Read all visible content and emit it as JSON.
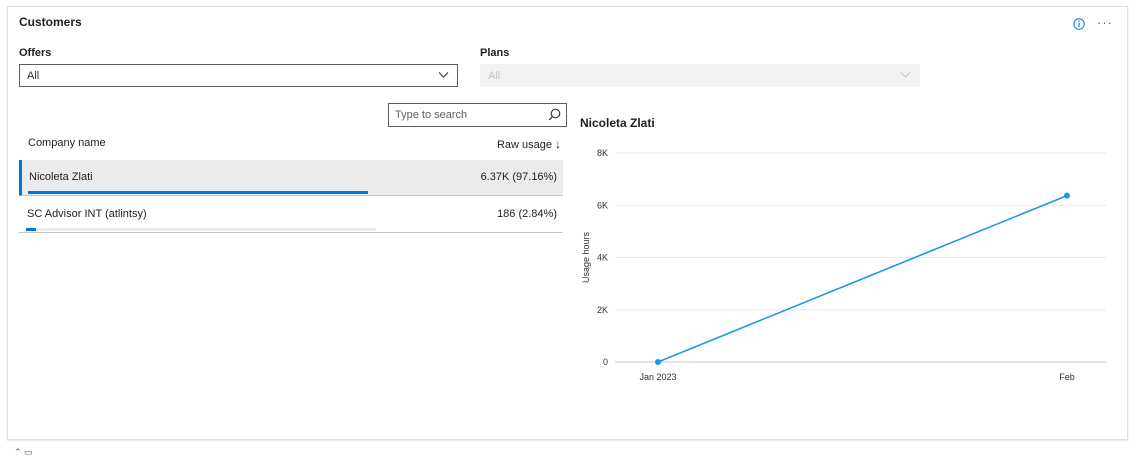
{
  "card": {
    "title": "Customers"
  },
  "filters": {
    "offers": {
      "label": "Offers",
      "value": "All"
    },
    "plans": {
      "label": "Plans",
      "value": "All",
      "disabled": true
    }
  },
  "search": {
    "placeholder": "Type to search"
  },
  "table": {
    "columns": {
      "company": "Company name",
      "usage": "Raw usage"
    },
    "rows": [
      {
        "name": "Nicoleta Zlati",
        "value": "6.37K (97.16%)",
        "share": 0.9716,
        "selected": true
      },
      {
        "name": "SC Advisor INT (atlintsy)",
        "value": "186 (2.84%)",
        "share": 0.0284,
        "selected": false
      }
    ]
  },
  "chart_data": {
    "type": "line",
    "title": "Nicoleta Zlati",
    "xlabel": "",
    "ylabel": "Usage hours",
    "categories": [
      "Jan 2023",
      "Feb"
    ],
    "series": [
      {
        "values": [
          0,
          6370
        ]
      }
    ],
    "yticks": [
      "0",
      "2K",
      "4K",
      "6K",
      "8K"
    ],
    "ylim": [
      0,
      8000
    ],
    "grid": true,
    "color": "#1a9be0"
  },
  "colors": {
    "accent": "#0078d4",
    "line": "#1a9be0"
  },
  "icons": {
    "info": "info-icon",
    "more": "more-icon",
    "search": "search-icon",
    "chevron": "chevron-down-icon"
  }
}
